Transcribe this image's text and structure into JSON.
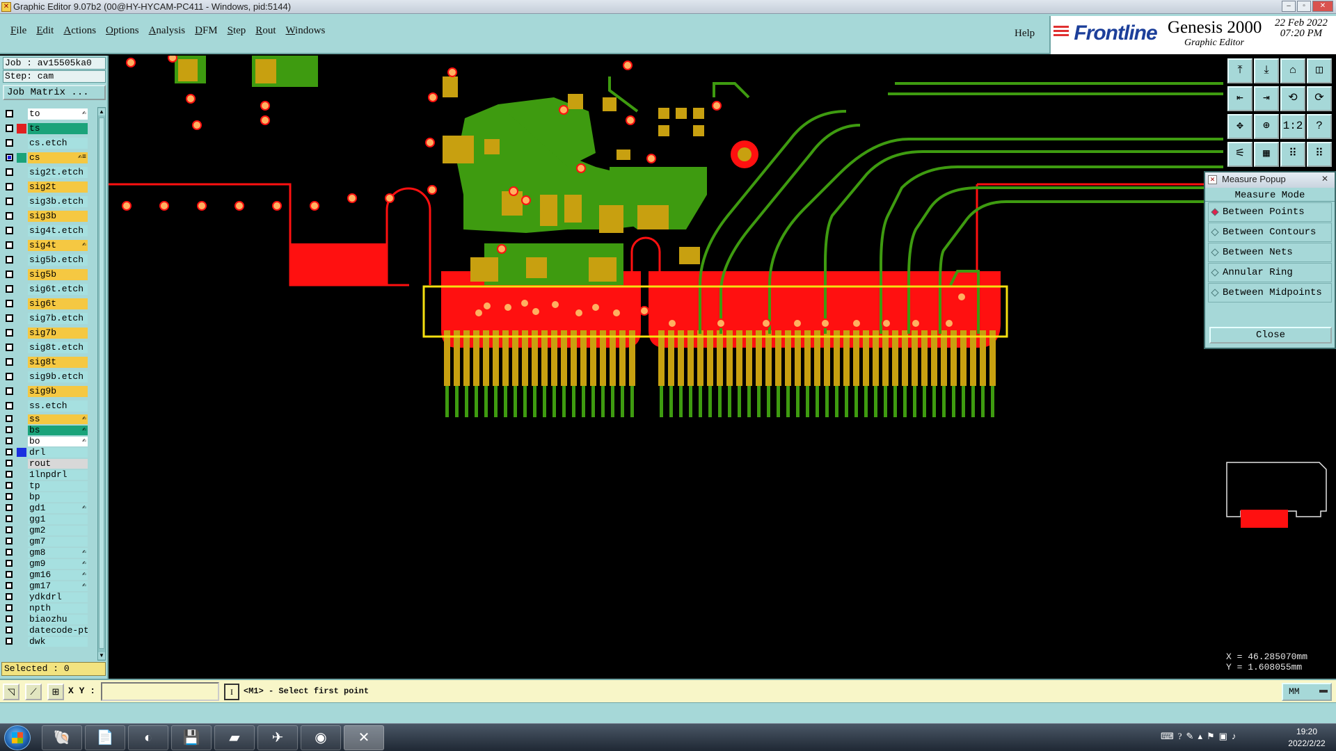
{
  "window": {
    "title": "Graphic Editor 9.07b2 (00@HY-HYCAM-PC411 - Windows, pid:5144)"
  },
  "menu": {
    "items": [
      {
        "label": "File",
        "mnemonic": "F",
        "rest": "ile"
      },
      {
        "label": "Edit",
        "mnemonic": "E",
        "rest": "dit"
      },
      {
        "label": "Actions",
        "mnemonic": "A",
        "rest": "ctions"
      },
      {
        "label": "Options",
        "mnemonic": "O",
        "rest": "ptions"
      },
      {
        "label": "Analysis",
        "mnemonic": "A",
        "rest": "nalysis"
      },
      {
        "label": "DFM",
        "mnemonic": "D",
        "rest": "FM"
      },
      {
        "label": "Step",
        "mnemonic": "S",
        "rest": "tep"
      },
      {
        "label": "Rout",
        "mnemonic": "R",
        "rest": "out"
      },
      {
        "label": "Windows",
        "mnemonic": "W",
        "rest": "indows"
      }
    ],
    "help": "Help"
  },
  "brand": {
    "logo": "Frontline",
    "product": "Genesis 2000",
    "subtitle": "Graphic Editor",
    "date": "22 Feb 2022",
    "time": "07:20 PM"
  },
  "job": {
    "job_line": "Job : av15505ka0",
    "step_line": "Step: cam",
    "matrix_button": "Job Matrix ..."
  },
  "layers": [
    {
      "name": "to",
      "color": "#ffffff",
      "edit": "✍",
      "compact": false,
      "selected": false
    },
    {
      "name": "ts",
      "color": "#1aa37a",
      "swatch": "#e02020",
      "compact": false,
      "selected": false
    },
    {
      "name": "cs.etch",
      "color": "#a6e0e0",
      "compact": false,
      "selected": false
    },
    {
      "name": "cs",
      "color": "#f5c842",
      "swatch": "#1aa37a",
      "edit": "✍≡",
      "compact": false,
      "selected": true
    },
    {
      "name": "sig2t.etch",
      "color": "#a6e0e0",
      "compact": false,
      "selected": false
    },
    {
      "name": "sig2t",
      "color": "#f5c842",
      "compact": false,
      "selected": false
    },
    {
      "name": "sig3b.etch",
      "color": "#a6e0e0",
      "compact": false,
      "selected": false
    },
    {
      "name": "sig3b",
      "color": "#f5c842",
      "compact": false,
      "selected": false
    },
    {
      "name": "sig4t.etch",
      "color": "#a6e0e0",
      "compact": false,
      "selected": false
    },
    {
      "name": "sig4t",
      "color": "#f5c842",
      "edit": "✍",
      "compact": false,
      "selected": false
    },
    {
      "name": "sig5b.etch",
      "color": "#a6e0e0",
      "compact": false,
      "selected": false
    },
    {
      "name": "sig5b",
      "color": "#f5c842",
      "compact": false,
      "selected": false
    },
    {
      "name": "sig6t.etch",
      "color": "#a6e0e0",
      "compact": false,
      "selected": false
    },
    {
      "name": "sig6t",
      "color": "#f5c842",
      "compact": false,
      "selected": false
    },
    {
      "name": "sig7b.etch",
      "color": "#a6e0e0",
      "compact": false,
      "selected": false
    },
    {
      "name": "sig7b",
      "color": "#f5c842",
      "compact": false,
      "selected": false
    },
    {
      "name": "sig8t.etch",
      "color": "#a6e0e0",
      "compact": false,
      "selected": false
    },
    {
      "name": "sig8t",
      "color": "#f5c842",
      "compact": false,
      "selected": false
    },
    {
      "name": "sig9b.etch",
      "color": "#a6e0e0",
      "compact": false,
      "selected": false
    },
    {
      "name": "sig9b",
      "color": "#f5c842",
      "compact": false,
      "selected": false
    },
    {
      "name": "ss.etch",
      "color": "#a6e0e0",
      "compact": false,
      "selected": false
    },
    {
      "name": "ss",
      "color": "#f5c842",
      "edit": "✍",
      "compact": true,
      "selected": false
    },
    {
      "name": "bs",
      "color": "#1aa37a",
      "edit": "✍",
      "compact": true,
      "selected": false
    },
    {
      "name": "bo",
      "color": "#ffffff",
      "edit": "✍",
      "compact": true,
      "selected": false
    },
    {
      "name": "drl",
      "color": "#a6e0e0",
      "swatch": "#1a30e0",
      "compact": true,
      "selected": false
    },
    {
      "name": "rout",
      "color": "#d8d8d8",
      "compact": true,
      "selected": false
    },
    {
      "name": "1lnpdrl",
      "color": "#a6e0e0",
      "compact": true,
      "selected": false
    },
    {
      "name": "tp",
      "color": "#a6e0e0",
      "compact": true,
      "selected": false
    },
    {
      "name": "bp",
      "color": "#a6e0e0",
      "compact": true,
      "selected": false
    },
    {
      "name": "gd1",
      "color": "#a6e0e0",
      "edit": "✍",
      "compact": true,
      "selected": false
    },
    {
      "name": "gg1",
      "color": "#a6e0e0",
      "compact": true,
      "selected": false
    },
    {
      "name": "gm2",
      "color": "#a6e0e0",
      "compact": true,
      "selected": false
    },
    {
      "name": "gm7",
      "color": "#a6e0e0",
      "compact": true,
      "selected": false
    },
    {
      "name": "gm8",
      "color": "#a6e0e0",
      "edit": "✍",
      "compact": true,
      "selected": false
    },
    {
      "name": "gm9",
      "color": "#a6e0e0",
      "edit": "✍",
      "compact": true,
      "selected": false
    },
    {
      "name": "gm16",
      "color": "#a6e0e0",
      "edit": "✍",
      "compact": true,
      "selected": false
    },
    {
      "name": "gm17",
      "color": "#a6e0e0",
      "edit": "✍",
      "compact": true,
      "selected": false
    },
    {
      "name": "ydkdrl",
      "color": "#a6e0e0",
      "compact": true,
      "selected": false
    },
    {
      "name": "npth",
      "color": "#a6e0e0",
      "compact": true,
      "selected": false
    },
    {
      "name": "biaozhu",
      "color": "#a6e0e0",
      "compact": true,
      "selected": false
    },
    {
      "name": "datecode-pt",
      "color": "#a6e0e0",
      "compact": true,
      "selected": false
    },
    {
      "name": "dwk",
      "color": "#a6e0e0",
      "compact": true,
      "selected": false
    }
  ],
  "selected_count": "Selected : 0",
  "toolbar_icons": [
    "snapshot-up-icon",
    "snapshot-down-icon",
    "home-icon",
    "fit-window-icon",
    "pan-left-icon",
    "pan-right-icon",
    "flip-icon",
    "redraw-icon",
    "zoom-fit-icon",
    "zoom-center-icon",
    "scale-1-2-icon",
    "query-icon",
    "ruler-icon",
    "grid-icon",
    "layer-filter-icon",
    "layer-filter-alt-icon"
  ],
  "toolbar_glyphs": [
    "⤒",
    "⤓",
    "⌂",
    "◫",
    "⇤",
    "⇥",
    "⟲",
    "⟳",
    "✥",
    "⊕",
    "1:2",
    "?",
    "⚟",
    "▦",
    "⠿",
    "⠿"
  ],
  "measure_popup": {
    "title": "Measure Popup",
    "mode_header": "Measure Mode",
    "options": [
      {
        "label": "Between Points",
        "active": true
      },
      {
        "label": "Between Contours",
        "active": false
      },
      {
        "label": "Between Nets",
        "active": false
      },
      {
        "label": "Annular Ring",
        "active": false
      },
      {
        "label": "Between Midpoints",
        "active": false
      }
    ],
    "close_label": "Close"
  },
  "coords": {
    "x": "X = 46.285070mm",
    "y": "Y = 1.608055mm"
  },
  "command": {
    "xy_label": "X Y :",
    "xy_value": "",
    "prompt": "<M1> - Select first point",
    "units": "MM"
  },
  "taskbar": {
    "time": "19:20",
    "date": "2022/2/22"
  },
  "colors": {
    "panel_teal": "#a6d8d8",
    "pcb_red": "#ff1010",
    "pcb_green": "#3e9b10",
    "pcb_gold": "#c8a010",
    "highlight_yellow": "#f5e010"
  }
}
